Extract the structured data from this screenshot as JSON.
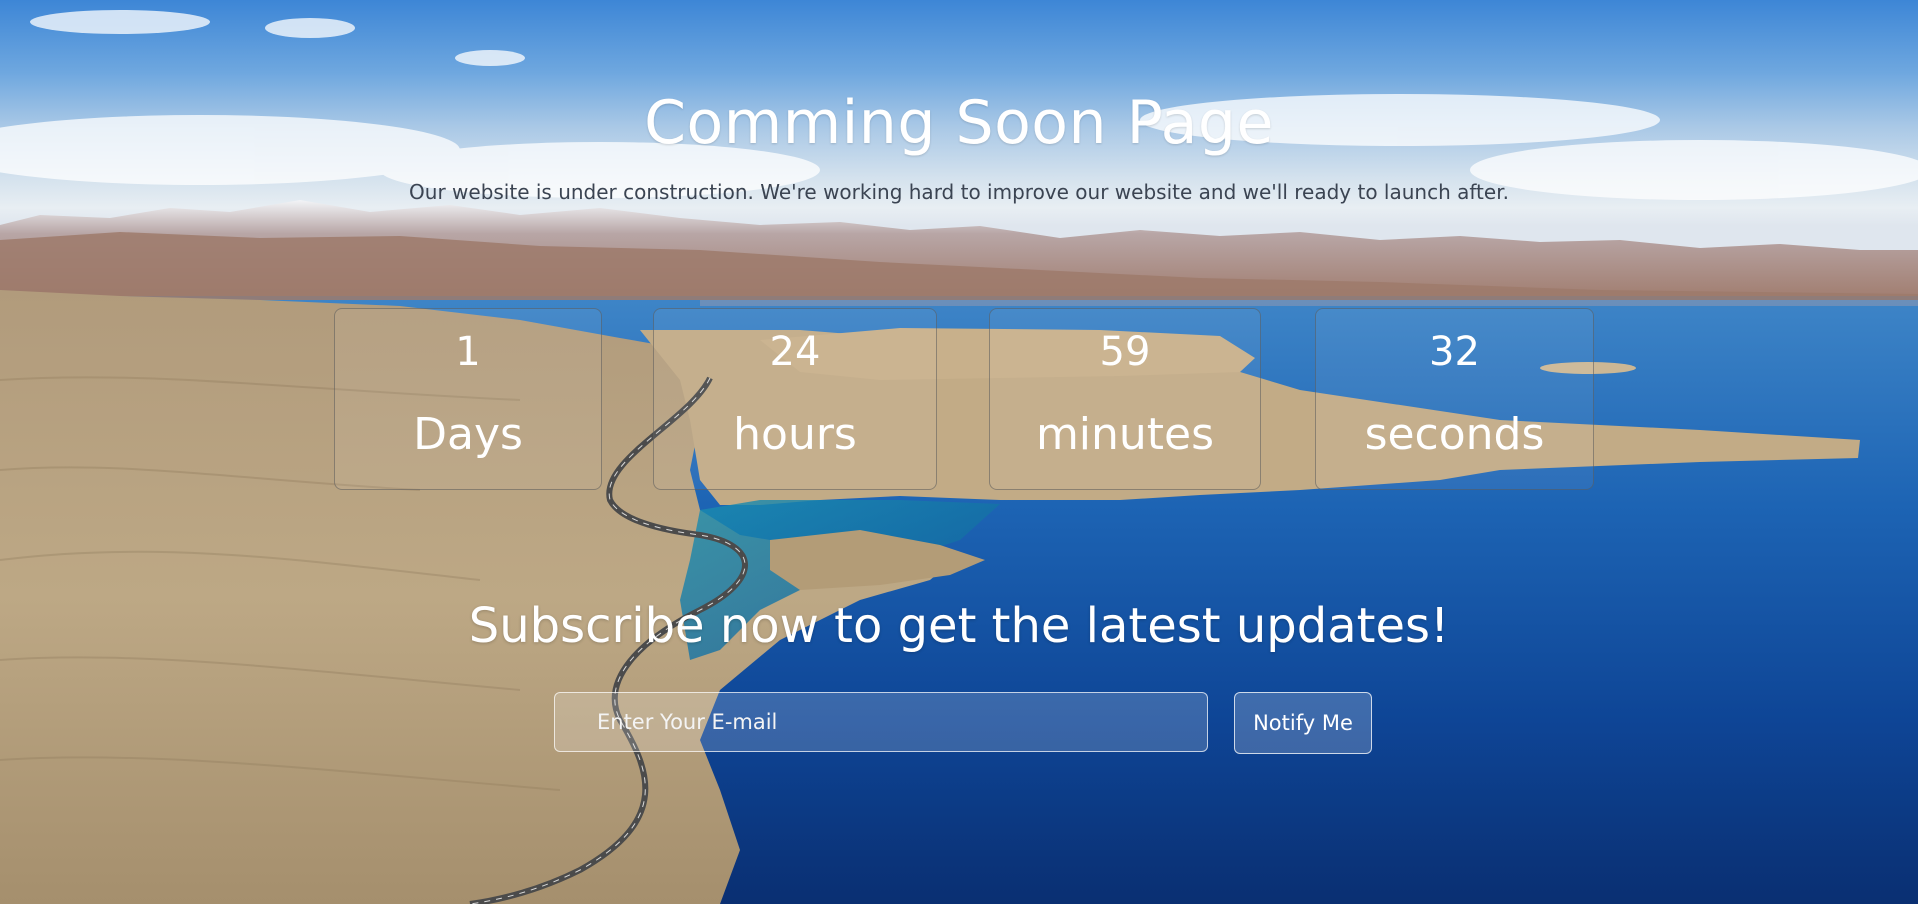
{
  "page": {
    "title": "Comming Soon Page",
    "subtitle": "Our website is under construction. We're working hard to improve our website and we'll ready to launch after."
  },
  "countdown": [
    {
      "value": "1",
      "label": "Days"
    },
    {
      "value": "24",
      "label": "hours"
    },
    {
      "value": "59",
      "label": "minutes"
    },
    {
      "value": "32",
      "label": "seconds"
    }
  ],
  "subscribe": {
    "heading": "Subscribe now to get the latest updates!",
    "email_placeholder": "Enter Your E-mail",
    "email_value": "",
    "button_label": "Notify Me"
  },
  "colors": {
    "sky": "#3d86d6",
    "lake": "#0b3f8f",
    "text_light": "#ffffff",
    "subtitle_text": "#3b4452"
  }
}
